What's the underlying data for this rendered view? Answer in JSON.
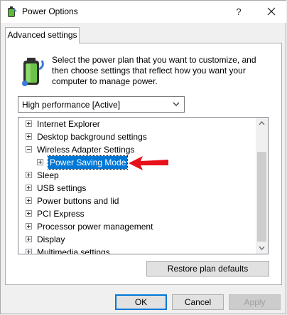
{
  "window": {
    "title": "Power Options",
    "help_label": "?",
    "close_icon": "close-icon"
  },
  "tab": {
    "label": "Advanced settings"
  },
  "description": {
    "lines": [
      "Select the power plan that you want to customize, and",
      "then choose settings that reflect how you want your",
      "computer to manage power."
    ]
  },
  "plan_select": {
    "value": "High performance [Active]"
  },
  "tree": {
    "items": [
      {
        "label": "Internet Explorer",
        "expander": "plus",
        "level": 0
      },
      {
        "label": "Desktop background settings",
        "expander": "plus",
        "level": 0
      },
      {
        "label": "Wireless Adapter Settings",
        "expander": "minus",
        "level": 0
      },
      {
        "label": "Power Saving Mode",
        "expander": "plus",
        "level": 1,
        "selected": true
      },
      {
        "label": "Sleep",
        "expander": "plus",
        "level": 0
      },
      {
        "label": "USB settings",
        "expander": "plus",
        "level": 0
      },
      {
        "label": "Power buttons and lid",
        "expander": "plus",
        "level": 0
      },
      {
        "label": "PCI Express",
        "expander": "plus",
        "level": 0
      },
      {
        "label": "Processor power management",
        "expander": "plus",
        "level": 0
      },
      {
        "label": "Display",
        "expander": "plus",
        "level": 0
      },
      {
        "label": "Multimedia settings",
        "expander": "plus",
        "level": 0
      }
    ]
  },
  "buttons": {
    "restore": "Restore plan defaults",
    "ok": "OK",
    "cancel": "Cancel",
    "apply": "Apply"
  },
  "colors": {
    "selection": "#0078d7",
    "annotation_arrow": "#e8101a"
  }
}
